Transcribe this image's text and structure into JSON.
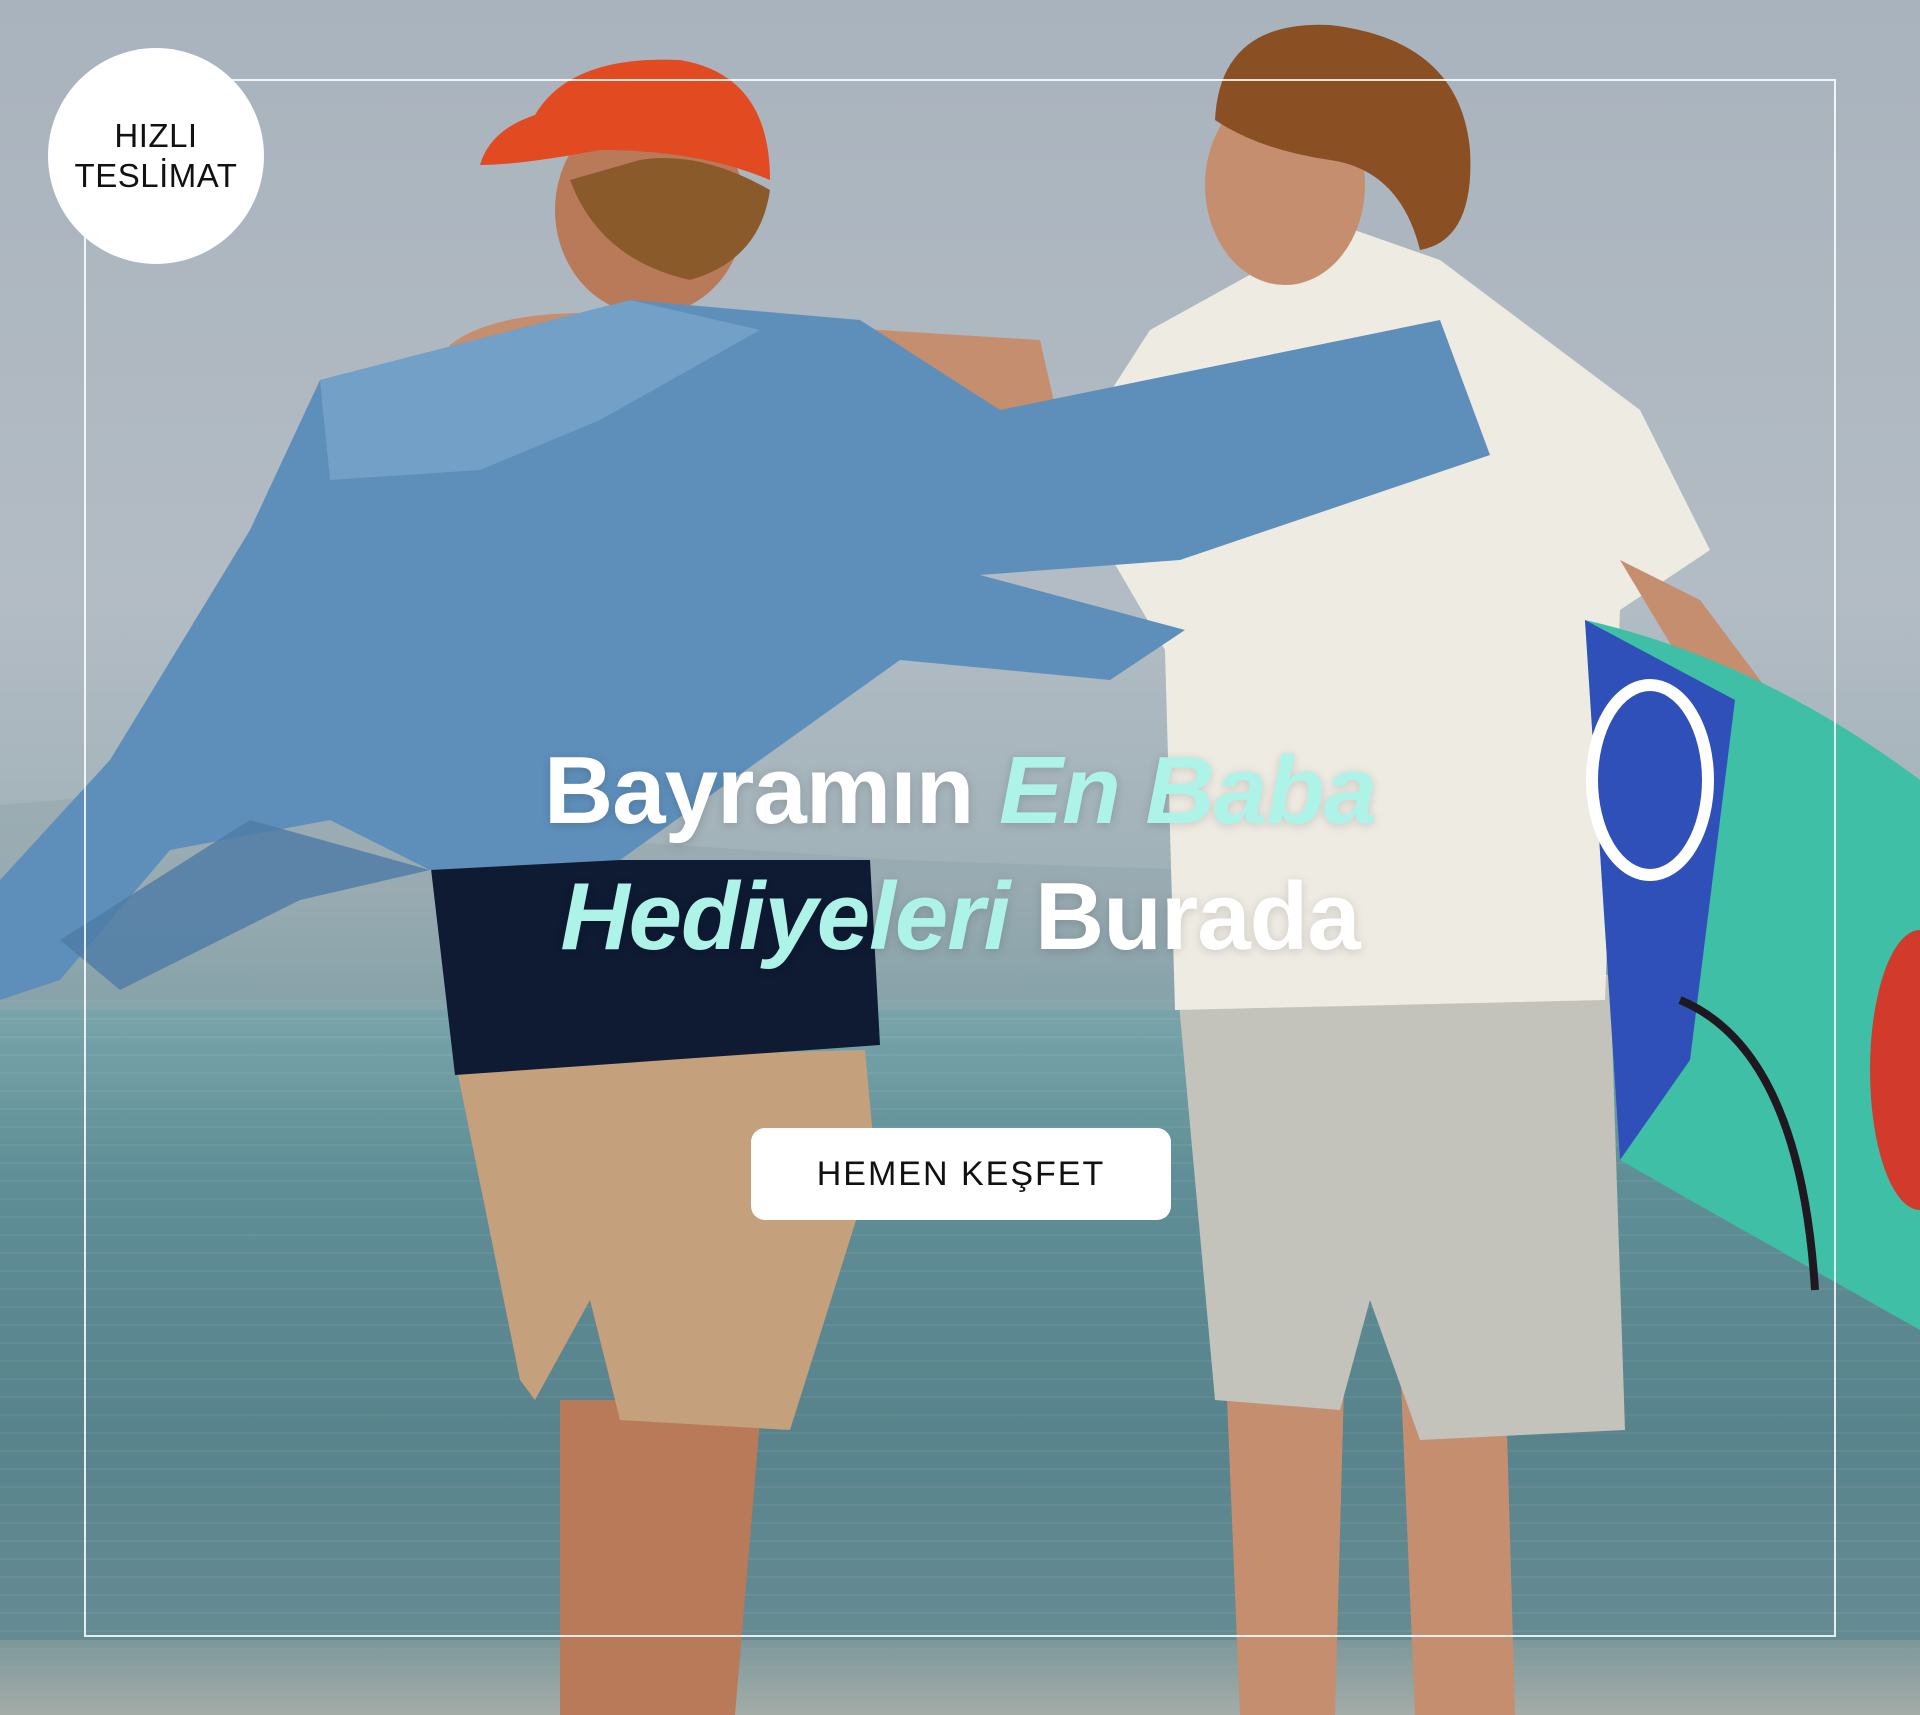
{
  "badge": {
    "line1": "HIZLI",
    "line2": "TESLİMAT"
  },
  "headline": {
    "line1_plain": "Bayramın ",
    "line1_accent": "En Baba",
    "line2_accent": "Hediyeleri",
    "line2_plain": " Burada"
  },
  "cta": {
    "label": "HEMEN KEŞFET"
  },
  "colors": {
    "accent": "#aef3e8",
    "text": "#ffffff",
    "button_bg": "#ffffff",
    "button_text": "#111111"
  }
}
